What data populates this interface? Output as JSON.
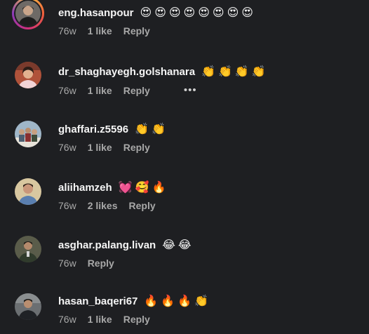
{
  "comments": [
    {
      "username": "eng.hasanpour",
      "emojis": "😍😍😍😍😍😍😍😍",
      "time": "76w",
      "likes": "1 like",
      "reply": "Reply",
      "avatar_icon": "person-avatar-story"
    },
    {
      "username": "dr_shaghayegh.golshanara",
      "emojis": "👏👏👏👏",
      "time": "76w",
      "likes": "1 like",
      "reply": "Reply",
      "more": "•••",
      "avatar_icon": "person-avatar"
    },
    {
      "username": "ghaffari.z5596",
      "emojis": "👏👏",
      "time": "76w",
      "likes": "1 like",
      "reply": "Reply",
      "avatar_icon": "group-avatar"
    },
    {
      "username": "aliihamzeh",
      "emojis": "💓🥰🔥",
      "time": "76w",
      "likes": "2 likes",
      "reply": "Reply",
      "avatar_icon": "person-avatar"
    },
    {
      "username": "asghar.palang.livan",
      "emojis": "😂😂",
      "time": "76w",
      "likes": "",
      "reply": "Reply",
      "avatar_icon": "person-avatar"
    },
    {
      "username": "hasan_baqeri67",
      "emojis": "🔥🔥🔥👏",
      "time": "76w",
      "likes": "1 like",
      "reply": "Reply",
      "avatar_icon": "person-avatar"
    }
  ]
}
